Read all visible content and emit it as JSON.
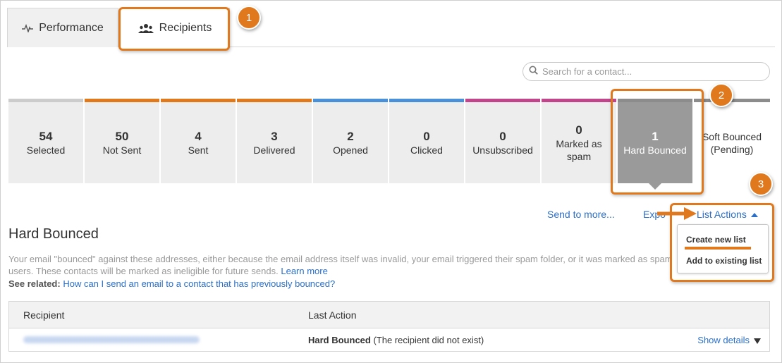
{
  "tabs": [
    {
      "label": "Performance",
      "icon": "pulse-icon"
    },
    {
      "label": "Recipients",
      "icon": "people-icon"
    }
  ],
  "search": {
    "placeholder": "Search for a contact..."
  },
  "stats": [
    {
      "value": "54",
      "label": "Selected",
      "color": "#cccccc"
    },
    {
      "value": "50",
      "label": "Not Sent",
      "color": "#e0781d"
    },
    {
      "value": "4",
      "label": "Sent",
      "color": "#e0781d"
    },
    {
      "value": "3",
      "label": "Delivered",
      "color": "#e0781d"
    },
    {
      "value": "2",
      "label": "Opened",
      "color": "#4a90d9"
    },
    {
      "value": "0",
      "label": "Clicked",
      "color": "#4a90d9"
    },
    {
      "value": "0",
      "label": "Unsubscribed",
      "color": "#c0458a"
    },
    {
      "value": "0",
      "label": "Marked as spam",
      "color": "#c0458a"
    },
    {
      "value": "1",
      "label": "Hard Bounced",
      "color": "#8c8c8c"
    },
    {
      "value": "",
      "label": "Soft Bounced (Pending)",
      "color": "#8c8c8c"
    }
  ],
  "actions": {
    "send_more": "Send to more...",
    "export": "Expo",
    "list_actions": "List Actions",
    "dropdown": [
      "Create new list",
      "Add to existing list"
    ]
  },
  "section": {
    "title": "Hard Bounced",
    "desc_line1": "Your email \"bounced\" against these addresses, either because the email address itself was invalid, your email triggered their spam folder, or it was marked as spam",
    "desc_line2": "users. These contacts will be marked as ineligible for future sends.",
    "learn_more": "Learn more",
    "see_related_label": "See related:",
    "see_related_link": "How can I send an email to a contact that has previously bounced?"
  },
  "table": {
    "headers": [
      "Recipient",
      "Last Action"
    ],
    "rows": [
      {
        "status": "Hard Bounced",
        "reason": "(The recipient did not exist)",
        "details": "Show details"
      }
    ]
  },
  "annotations": {
    "steps": [
      "1",
      "2",
      "3"
    ],
    "accent": "#e0781d"
  }
}
